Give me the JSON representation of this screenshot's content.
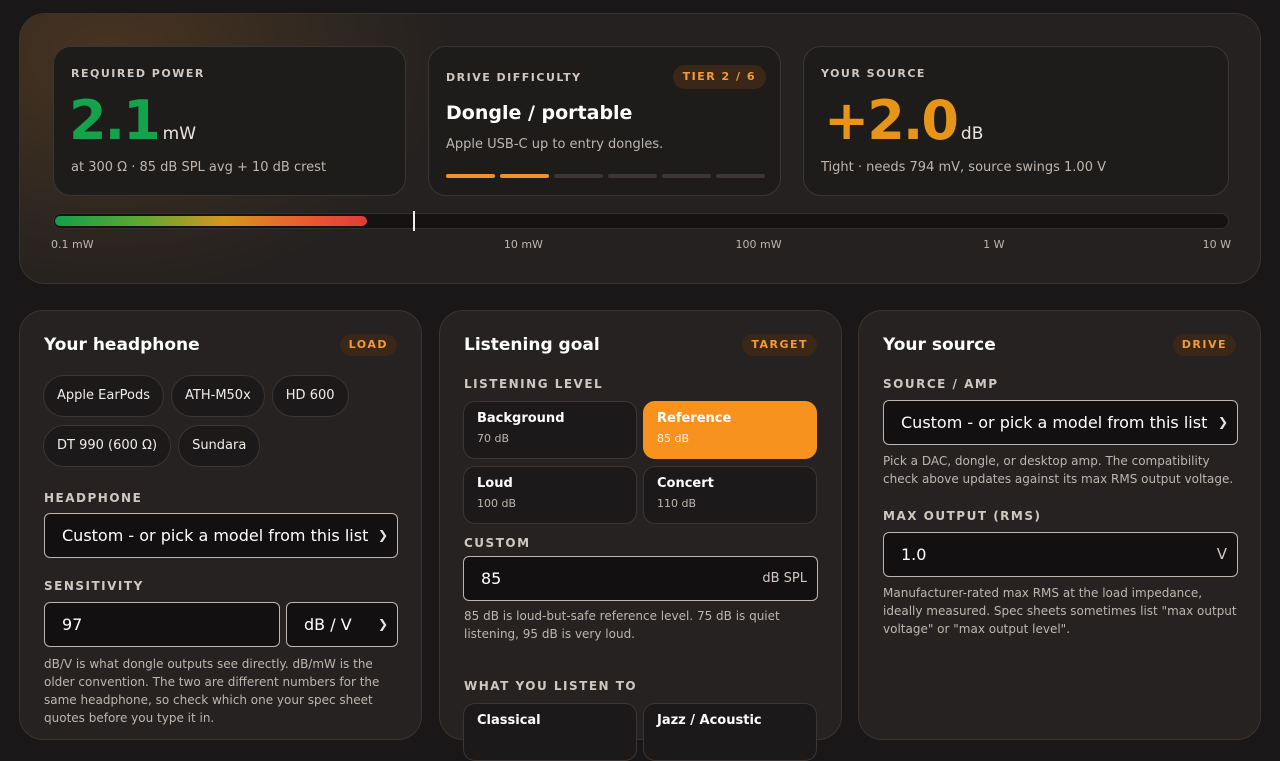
{
  "summary": {
    "required_power": {
      "label": "REQUIRED POWER",
      "value": "2.1",
      "unit": "mW",
      "sub": "at 300 Ω · 85 dB SPL avg + 10 dB crest",
      "color": "#14a34c"
    },
    "drive_difficulty": {
      "label": "DRIVE DIFFICULTY",
      "badge": "TIER 2 / 6",
      "title": "Dongle / portable",
      "sub": "Apple USB-C up to entry dongles.",
      "tier": 2,
      "tiers": 6
    },
    "your_source": {
      "label": "YOUR SOURCE",
      "value": "+2.0",
      "unit": "dB",
      "sub": "Tight · needs 794 mV, source swings 1.00 V",
      "color": "#e69519"
    }
  },
  "meter": {
    "fill_fraction": 0.265,
    "marker_fraction": 0.305,
    "ticks": [
      {
        "label": "0.1 mW",
        "pos": 0
      },
      {
        "label": "10 mW",
        "pos": 0.4
      },
      {
        "label": "100 mW",
        "pos": 0.6
      },
      {
        "label": "1 W",
        "pos": 0.8
      },
      {
        "label": "10 W",
        "pos": 1
      }
    ]
  },
  "headphone": {
    "title": "Your headphone",
    "badge": "LOAD",
    "presets": [
      "Apple EarPods",
      "ATH-M50x",
      "HD 600",
      "DT 990 (600 Ω)",
      "Sundara"
    ],
    "model_label": "HEADPHONE",
    "model_value": "Custom - or pick a model from this list",
    "sensitivity_label": "SENSITIVITY",
    "sensitivity_value": "97",
    "sensitivity_unit": "dB / V",
    "sensitivity_help": "dB/V is what dongle outputs see directly. dB/mW is the older convention. The two are different numbers for the same headphone, so check which one your spec sheet quotes before you type it in."
  },
  "goal": {
    "title": "Listening goal",
    "badge": "TARGET",
    "level_label": "LISTENING LEVEL",
    "levels": [
      {
        "name": "Background",
        "db": "70 dB",
        "active": false
      },
      {
        "name": "Reference",
        "db": "85 dB",
        "active": true
      },
      {
        "name": "Loud",
        "db": "100 dB",
        "active": false
      },
      {
        "name": "Concert",
        "db": "110 dB",
        "active": false
      }
    ],
    "custom_label": "CUSTOM",
    "custom_value": "85",
    "custom_unit": "dB SPL",
    "custom_help": "85 dB is loud-but-safe reference level. 75 dB is quiet listening, 95 dB is very loud.",
    "genre_label": "WHAT YOU LISTEN TO",
    "genres": [
      "Classical",
      "Jazz / Acoustic"
    ]
  },
  "source": {
    "title": "Your source",
    "badge": "DRIVE",
    "amp_label": "SOURCE / AMP",
    "amp_value": "Custom - or pick a model from this list",
    "amp_help": "Pick a DAC, dongle, or desktop amp. The compatibility check above updates against its max RMS output voltage.",
    "output_label": "MAX OUTPUT (RMS)",
    "output_value": "1.0",
    "output_unit": "V",
    "output_help": "Manufacturer-rated max RMS at the load impedance, ideally measured. Spec sheets sometimes list \"max output voltage\" or \"max output level\"."
  }
}
